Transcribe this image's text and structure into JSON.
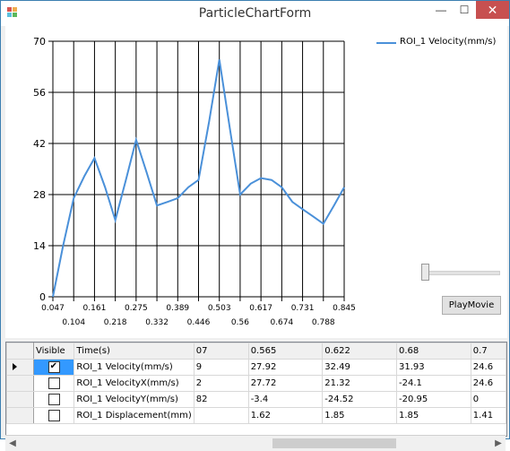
{
  "window": {
    "title": "ParticleChartForm",
    "minimize": "—",
    "maximize": "☐",
    "close": "✕"
  },
  "colors": {
    "series": "#4a90d9",
    "close_button": "#c75050",
    "grid": "#000000"
  },
  "chart_data": {
    "type": "line",
    "series": [
      {
        "name": "ROI_1 Velocity(mm/s)",
        "x": [
          0.047,
          0.075,
          0.104,
          0.133,
          0.161,
          0.19,
          0.218,
          0.247,
          0.275,
          0.304,
          0.332,
          0.361,
          0.389,
          0.418,
          0.446,
          0.475,
          0.503,
          0.532,
          0.56,
          0.589,
          0.617,
          0.646,
          0.674,
          0.703,
          0.731,
          0.76,
          0.788,
          0.817,
          0.845
        ],
        "y": [
          0,
          14,
          27,
          33,
          38,
          30,
          21,
          32,
          43,
          34,
          25,
          26,
          27,
          30,
          32,
          48,
          65,
          46,
          28,
          31,
          32.5,
          32,
          30,
          26,
          24,
          22,
          20,
          25,
          30
        ]
      }
    ],
    "xticks_top": [
      "0.047",
      "0.161",
      "0.275",
      "0.389",
      "0.503",
      "0.617",
      "0.731",
      "0.845"
    ],
    "xticks_bottom": [
      "0.104",
      "0.218",
      "0.332",
      "0.446",
      "0.56",
      "0.674",
      "0.788"
    ],
    "yticks": [
      "0",
      "14",
      "28",
      "42",
      "56",
      "70"
    ],
    "ylim": [
      0,
      70
    ],
    "xlim": [
      0.047,
      0.845
    ],
    "grid": true,
    "legend_position": "top-right"
  },
  "controls": {
    "play_label": "PlayMovie"
  },
  "grid": {
    "headers": [
      "Visible",
      "Time(s)",
      "07",
      "0.565",
      "0.622",
      "0.68",
      "0.7"
    ],
    "rows": [
      {
        "visible": true,
        "label": "ROI_1 Velocity(mm/s)",
        "cells": [
          "9",
          "27.92",
          "32.49",
          "31.93",
          "24.6"
        ]
      },
      {
        "visible": false,
        "label": "ROI_1 VelocityX(mm/s)",
        "cells": [
          "2",
          "27.72",
          "21.32",
          "-24.1",
          "24.6"
        ]
      },
      {
        "visible": false,
        "label": "ROI_1 VelocityY(mm/s)",
        "cells": [
          "82",
          "-3.4",
          "-24.52",
          "-20.95",
          "0"
        ]
      },
      {
        "visible": false,
        "label": "ROI_1 Displacement(mm)",
        "cells": [
          "",
          "1.62",
          "1.85",
          "1.85",
          "1.41"
        ]
      }
    ]
  }
}
